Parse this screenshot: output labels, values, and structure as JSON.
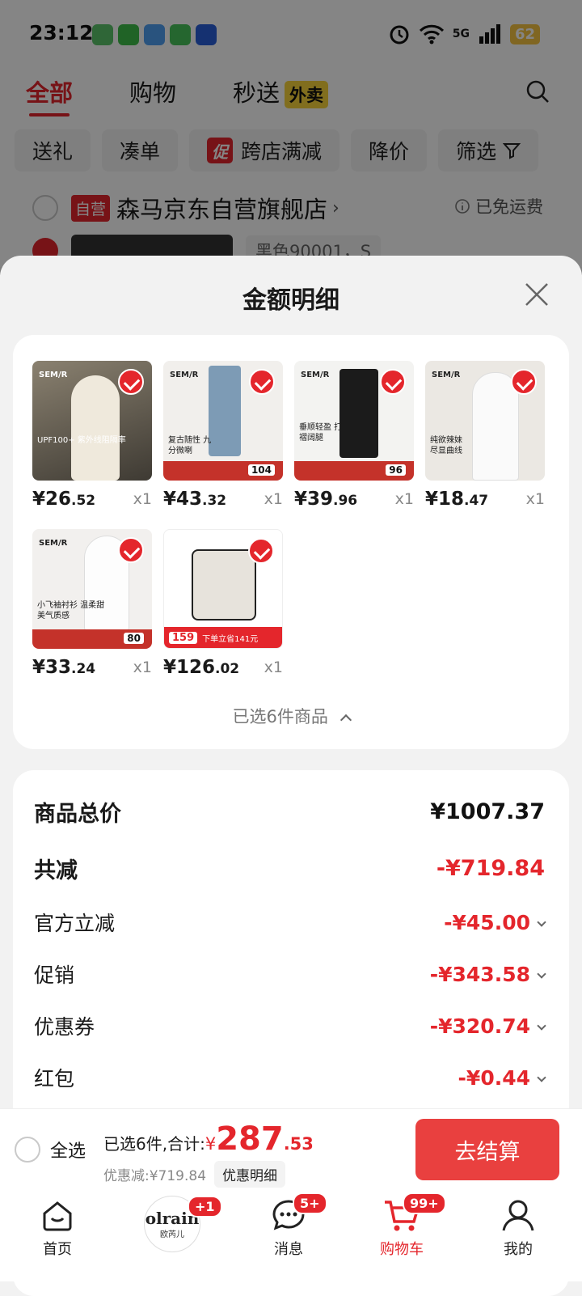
{
  "status": {
    "time": "23:12",
    "network": "5G",
    "battery": "62"
  },
  "tabs": {
    "all": "全部",
    "shopping": "购物",
    "express": "秒送",
    "express_badge": "外卖"
  },
  "chips": {
    "gift": "送礼",
    "combine": "凑单",
    "promo_tag": "促",
    "cross_store": "跨店满减",
    "price_drop": "降价",
    "filter": "筛选"
  },
  "store": {
    "tag": "自营",
    "name": "森马京东自营旗舰店",
    "shipping": "已免运费",
    "variant": "黑色90001，S"
  },
  "sheet": {
    "title": "金额明细"
  },
  "products": [
    {
      "price_int": "¥26",
      "price_dec": ".52",
      "qty": "x1",
      "img_text": "UPF100+ 紫外线阻隔率",
      "brand": "SEM/R"
    },
    {
      "price_int": "¥43",
      "price_dec": ".32",
      "qty": "x1",
      "img_text": "复古随性 九分微喇",
      "brand": "SEM/R",
      "tag_price": "104"
    },
    {
      "price_int": "¥39",
      "price_dec": ".96",
      "qty": "x1",
      "img_text": "垂顺轻盈 打褶阔腿",
      "brand": "SEM/R",
      "tag_price": "96"
    },
    {
      "price_int": "¥18",
      "price_dec": ".47",
      "qty": "x1",
      "img_text": "纯欲辣妹 尽显曲线",
      "brand": "SEM/R"
    },
    {
      "price_int": "¥33",
      "price_dec": ".24",
      "qty": "x1",
      "img_text": "小飞袖衬衫 温柔甜美气质感",
      "brand": "SEM/R",
      "tag_price": "80"
    },
    {
      "price_int": "¥126",
      "price_dec": ".02",
      "qty": "x1",
      "img_text": "下单立省141元",
      "brand": "",
      "tag_price": "159"
    }
  ],
  "selected_text": "已选6件商品",
  "summary": [
    {
      "label": "商品总价",
      "value": "¥1007.37",
      "style": "total"
    },
    {
      "label": "共减",
      "value": "-¥719.84",
      "style": "bold"
    },
    {
      "label": "官方立减",
      "value": "-¥45.00",
      "style": "item"
    },
    {
      "label": "促销",
      "value": "-¥343.58",
      "style": "item"
    },
    {
      "label": "优惠券",
      "value": "-¥320.74",
      "style": "item"
    },
    {
      "label": "红包",
      "value": "-¥0.44",
      "style": "item"
    }
  ],
  "checkout": {
    "select_all": "全选",
    "selected_label": "已选6件,合计:",
    "yen": "¥",
    "total_int": "287",
    "total_dec": ".53",
    "discount_label": "优惠减:¥719.84",
    "detail_button": "优惠明细",
    "pay_button": "去结算"
  },
  "nav": {
    "home": "首页",
    "brand": "欧芮儿",
    "brand_logo": "olrain",
    "brand_badge": "+1",
    "messages": "消息",
    "messages_badge": "5+",
    "cart": "购物车",
    "cart_badge": "99+",
    "me": "我的"
  },
  "colors": {
    "accent": "#e4262c",
    "pay": "#e9403f"
  }
}
